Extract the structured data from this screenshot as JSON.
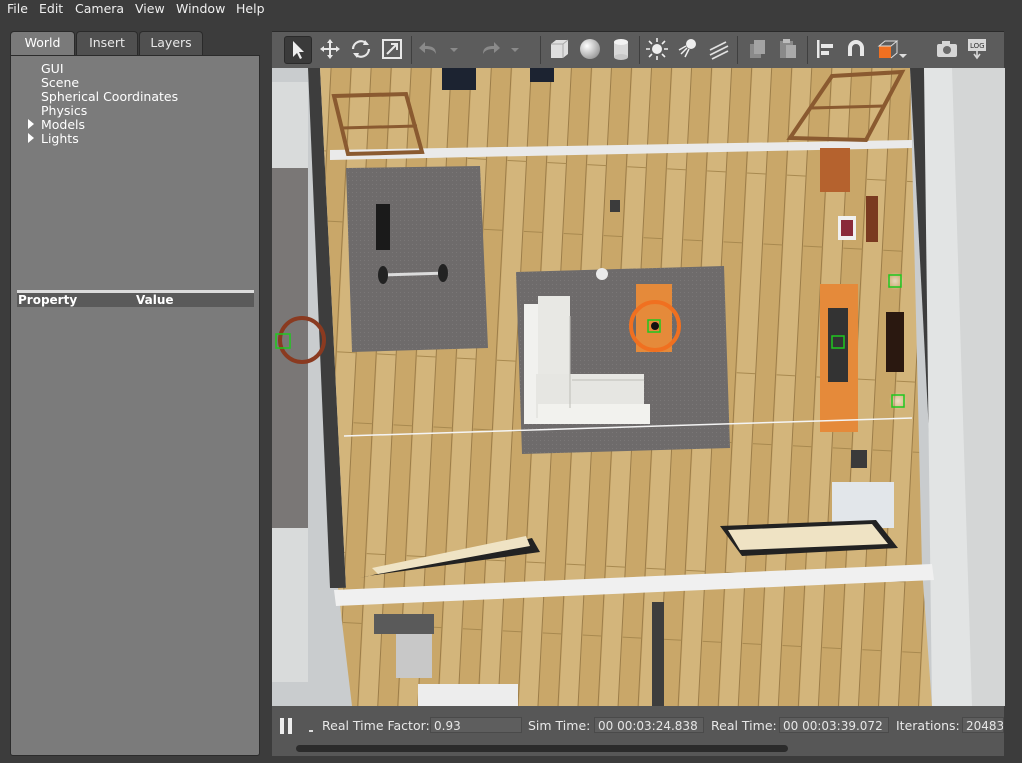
{
  "menu": {
    "items": [
      "File",
      "Edit",
      "Camera",
      "View",
      "Window",
      "Help"
    ]
  },
  "left_panel": {
    "tabs": [
      "World",
      "Insert",
      "Layers"
    ],
    "active_tab": "World",
    "tree": [
      {
        "label": "GUI",
        "expandable": false
      },
      {
        "label": "Scene",
        "expandable": false
      },
      {
        "label": "Spherical Coordinates",
        "expandable": false
      },
      {
        "label": "Physics",
        "expandable": false
      },
      {
        "label": "Models",
        "expandable": true
      },
      {
        "label": "Lights",
        "expandable": true
      }
    ],
    "property_header": {
      "property": "Property",
      "value": "Value"
    }
  },
  "toolbar": {
    "tools": [
      "select-mode",
      "translate-mode",
      "rotate-mode",
      "scale-mode",
      "undo",
      "undo-history",
      "redo",
      "redo-history",
      "box-shape",
      "sphere-shape",
      "cylinder-shape",
      "point-light",
      "spot-light",
      "directional-light",
      "copy",
      "paste",
      "align",
      "snap",
      "view-angle",
      "screenshot",
      "log"
    ],
    "active_tool": "select-mode",
    "accent_color": "#f07020"
  },
  "status": {
    "real_time_factor_label": "Real Time Factor:",
    "real_time_factor": "0.93",
    "sim_time_label": "Sim Time:",
    "sim_time": "00 00:03:24.838",
    "real_time_label": "Real Time:",
    "real_time": "00 00:03:39.072",
    "iterations_label": "Iterations:",
    "iterations": "20483"
  },
  "colors": {
    "panel": "#7b7b7b",
    "toolbar": "#5c5c5c",
    "background": "#3c3c3c",
    "floor_wood": "#c9a668",
    "rug": "#6b6868",
    "wall": "#e6e8e8"
  }
}
